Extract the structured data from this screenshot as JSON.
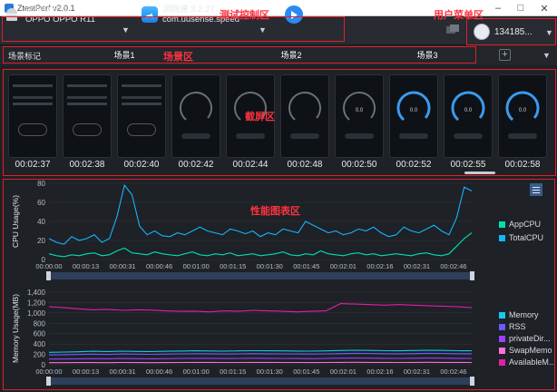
{
  "window": {
    "title": "ZtestPerf v2.0.1"
  },
  "device": {
    "line1": "OPPO R11",
    "line2": "OPPO OPPO R11"
  },
  "app": {
    "name": "测网速 3.2.27",
    "package": "com.uusense.speed"
  },
  "user": {
    "account": "134185..."
  },
  "annotations": {
    "control": "测试控制区",
    "user_menu": "用户菜单区",
    "scene": "场景区",
    "screenshot": "截屏区",
    "chart": "性能图表区"
  },
  "scenes": {
    "label": "场景标记",
    "items": [
      {
        "label": "场景1",
        "color": "#8a1fe0"
      },
      {
        "label": "场景2",
        "color": "#ff84d2"
      },
      {
        "label": "场景3",
        "color": "#1e90ff"
      }
    ]
  },
  "screenshots": [
    "00:02:37",
    "00:02:38",
    "00:02:40",
    "00:02:42",
    "00:02:44",
    "00:02:48",
    "00:02:50",
    "00:02:52",
    "00:02:55",
    "00:02:58"
  ],
  "colors": {
    "cpu_app": "#00e0b0",
    "cpu_total": "#14b4ff",
    "memory": "#18c8f0",
    "rss": "#6a5aff",
    "private_dirty": "#9a40ff",
    "swap": "#ff70d8",
    "available": "#e020a8"
  },
  "chart_data": [
    {
      "type": "line",
      "ylabel": "CPU Usage(%)",
      "ylim": [
        0,
        80
      ],
      "yticks": [
        "80",
        "60",
        "40",
        "20",
        "0"
      ],
      "xticks": [
        "00:00:00",
        "00:00:13",
        "00:00:31",
        "00:00:46",
        "00:01:00",
        "00:01:15",
        "00:01:30",
        "00:01:45",
        "00:02:01",
        "00:02:16",
        "00:02:31",
        "00:02:46"
      ],
      "series": [
        {
          "name": "AppCPU",
          "values": [
            6,
            4,
            3,
            5,
            4,
            6,
            7,
            4,
            5,
            9,
            12,
            7,
            6,
            5,
            8,
            6,
            5,
            4,
            6,
            8,
            5,
            4,
            6,
            5,
            7,
            4,
            5,
            6,
            4,
            5,
            6,
            8,
            5,
            4,
            6,
            5,
            9,
            6,
            5,
            4,
            6,
            7,
            5,
            6,
            4,
            5,
            6,
            5,
            4,
            6,
            7,
            5,
            4,
            6,
            14,
            22,
            28
          ]
        },
        {
          "name": "TotalCPU",
          "values": [
            22,
            18,
            16,
            24,
            20,
            22,
            26,
            18,
            22,
            45,
            78,
            68,
            35,
            26,
            30,
            25,
            24,
            28,
            26,
            30,
            34,
            30,
            28,
            26,
            32,
            30,
            27,
            30,
            24,
            28,
            26,
            32,
            30,
            28,
            40,
            36,
            32,
            28,
            30,
            26,
            28,
            32,
            30,
            34,
            28,
            24,
            26,
            34,
            30,
            28,
            32,
            36,
            30,
            26,
            44,
            76,
            72
          ]
        }
      ]
    },
    {
      "type": "line",
      "ylabel": "Memory Usage(MB)",
      "ylim": [
        0,
        1400
      ],
      "yticks": [
        "1,400",
        "1,200",
        "1,000",
        "800",
        "600",
        "400",
        "200",
        "0"
      ],
      "xticks": [
        "00:00:00",
        "00:00:13",
        "00:00:31",
        "00:00:46",
        "00:01:00",
        "00:01:15",
        "00:01:30",
        "00:01:45",
        "00:02:01",
        "00:02:16",
        "00:02:31",
        "00:02:46"
      ],
      "series": [
        {
          "name": "Memory",
          "values": [
            240,
            245,
            250,
            260,
            255,
            262,
            258,
            255,
            260,
            265,
            270,
            266,
            262,
            268,
            272,
            270,
            268,
            265,
            262,
            268,
            275,
            280,
            276,
            272,
            270,
            274,
            278,
            276,
            272,
            270
          ]
        },
        {
          "name": "RSS",
          "values": [
            190,
            195,
            200,
            205,
            200,
            208,
            205,
            202,
            206,
            210,
            214,
            212,
            208,
            210,
            215,
            212,
            210,
            208,
            206,
            210,
            216,
            220,
            218,
            214,
            212,
            216,
            220,
            218,
            214,
            212
          ]
        },
        {
          "name": "privateDir...",
          "values": [
            110,
            112,
            115,
            118,
            116,
            120,
            118,
            116,
            118,
            122,
            125,
            124,
            120,
            122,
            126,
            124,
            122,
            120,
            118,
            122,
            128,
            130,
            128,
            124,
            122,
            126,
            130,
            128,
            124,
            122
          ]
        },
        {
          "name": "SwapMemo",
          "values": [
            40,
            40,
            42,
            42,
            41,
            43,
            42,
            41,
            42,
            44,
            45,
            45,
            44,
            44,
            46,
            45,
            44,
            43,
            42,
            44,
            46,
            47,
            46,
            45,
            44,
            46,
            47,
            46,
            45,
            44
          ]
        },
        {
          "name": "AvailableM...",
          "values": [
            1120,
            1100,
            1080,
            1060,
            1070,
            1050,
            1060,
            1055,
            1040,
            1030,
            1035,
            1020,
            1040,
            1030,
            1050,
            1040,
            1030,
            1020,
            1030,
            1040,
            1180,
            1170,
            1160,
            1150,
            1160,
            1150,
            1140,
            1130,
            1120,
            1100
          ]
        }
      ]
    }
  ]
}
